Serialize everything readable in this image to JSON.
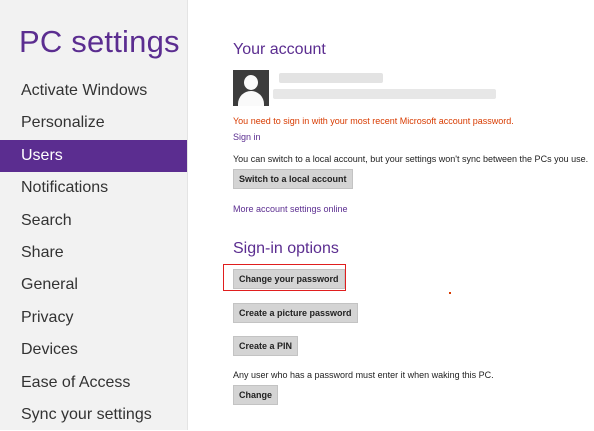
{
  "sidebar": {
    "title": "PC settings",
    "items": [
      {
        "label": "Activate Windows",
        "selected": false
      },
      {
        "label": "Personalize",
        "selected": false
      },
      {
        "label": "Users",
        "selected": true
      },
      {
        "label": "Notifications",
        "selected": false
      },
      {
        "label": "Search",
        "selected": false
      },
      {
        "label": "Share",
        "selected": false
      },
      {
        "label": "General",
        "selected": false
      },
      {
        "label": "Privacy",
        "selected": false
      },
      {
        "label": "Devices",
        "selected": false
      },
      {
        "label": "Ease of Access",
        "selected": false
      },
      {
        "label": "Sync your settings",
        "selected": false
      }
    ]
  },
  "account": {
    "title": "Your account",
    "name_redacted": true,
    "email_redacted": true,
    "warning": "You need to sign in with your most recent Microsoft account password.",
    "sign_in_link": "Sign in",
    "local_info": "You can switch to a local account, but your settings won't sync between the PCs you use.",
    "switch_button": "Switch to a local account",
    "more_link": "More account settings online"
  },
  "signin": {
    "title": "Sign-in options",
    "change_password_button": "Change your password",
    "picture_password_button": "Create a picture password",
    "pin_button": "Create a PIN",
    "policy_text": "Any user who has a password must enter it when waking this PC.",
    "change_button": "Change"
  },
  "colors": {
    "accent": "#5b2d90",
    "warning": "#d83b01",
    "highlight": "#e01e1e",
    "sidebar_bg": "#f2f2f2"
  }
}
